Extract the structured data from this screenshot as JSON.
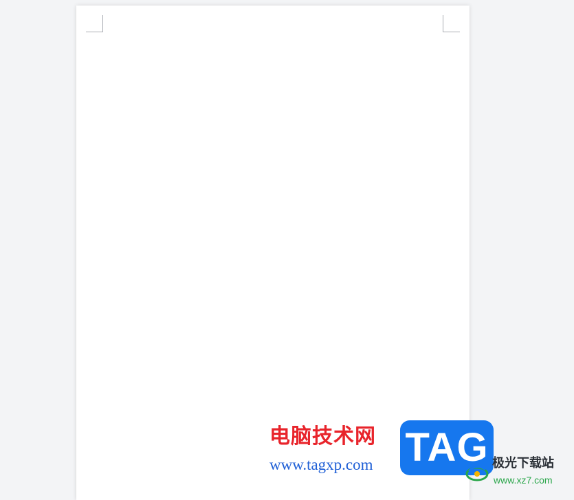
{
  "document": {
    "body_text": ""
  },
  "watermarks": {
    "site_cn": "电脑技术网",
    "site_url": "www.tagxp.com",
    "tag_logo": "TAG",
    "jiguang_cn": "极光下载站",
    "jiguang_url": "www.xz7.com"
  },
  "colors": {
    "workspace_bg": "#f3f4f6",
    "page_bg": "#ffffff",
    "site_cn": "#e8242b",
    "site_url": "#1f5fd6",
    "tag_logo_bg": "#1677ee",
    "jiguang_url": "#2aa64a"
  }
}
